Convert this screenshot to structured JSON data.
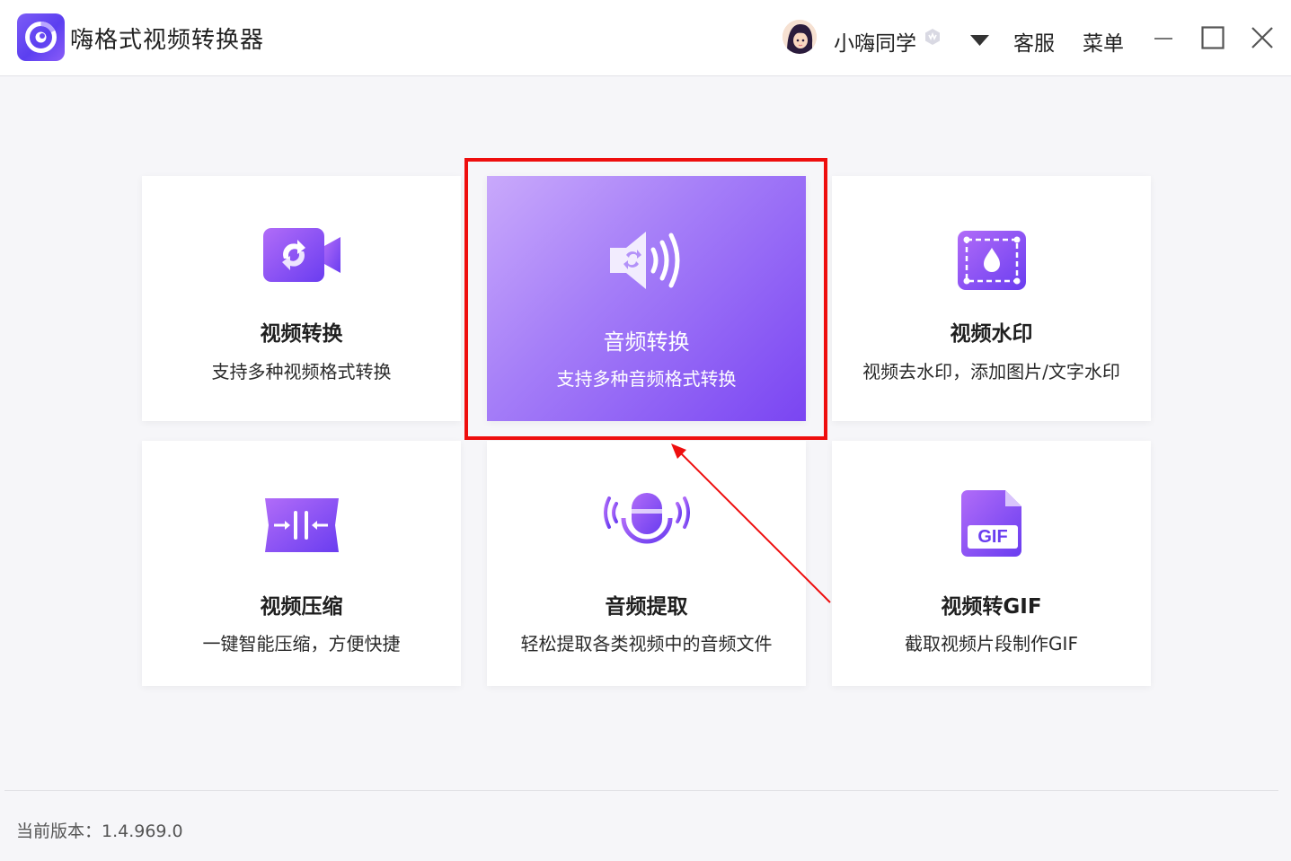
{
  "app": {
    "title": "嗨格式视频转换器"
  },
  "header": {
    "username": "小嗨同学",
    "customer_service": "客服",
    "menu": "菜单"
  },
  "cards": [
    {
      "id": "video-convert",
      "title": "视频转换",
      "desc": "支持多种视频格式转换",
      "icon": "video-convert-icon"
    },
    {
      "id": "audio-convert",
      "title": "音频转换",
      "desc": "支持多种音频格式转换",
      "icon": "audio-convert-icon",
      "active": true
    },
    {
      "id": "video-watermark",
      "title": "视频水印",
      "desc": "视频去水印，添加图片/文字水印",
      "icon": "watermark-icon"
    },
    {
      "id": "video-compress",
      "title": "视频压缩",
      "desc": "一键智能压缩，方便快捷",
      "icon": "compress-icon"
    },
    {
      "id": "audio-extract",
      "title": "音频提取",
      "desc": "轻松提取各类视频中的音频文件",
      "icon": "microphone-icon"
    },
    {
      "id": "video-gif",
      "title": "视频转GIF",
      "desc": "截取视频片段制作GIF",
      "icon": "gif-file-icon",
      "icon_text": "GIF"
    }
  ],
  "footer": {
    "version": "当前版本：1.4.969.0"
  },
  "colors": {
    "accent_start": "#c9a9fb",
    "accent_end": "#7a45f2",
    "icon_purple": "#7b4df3",
    "highlight": "#ee0e0e"
  }
}
